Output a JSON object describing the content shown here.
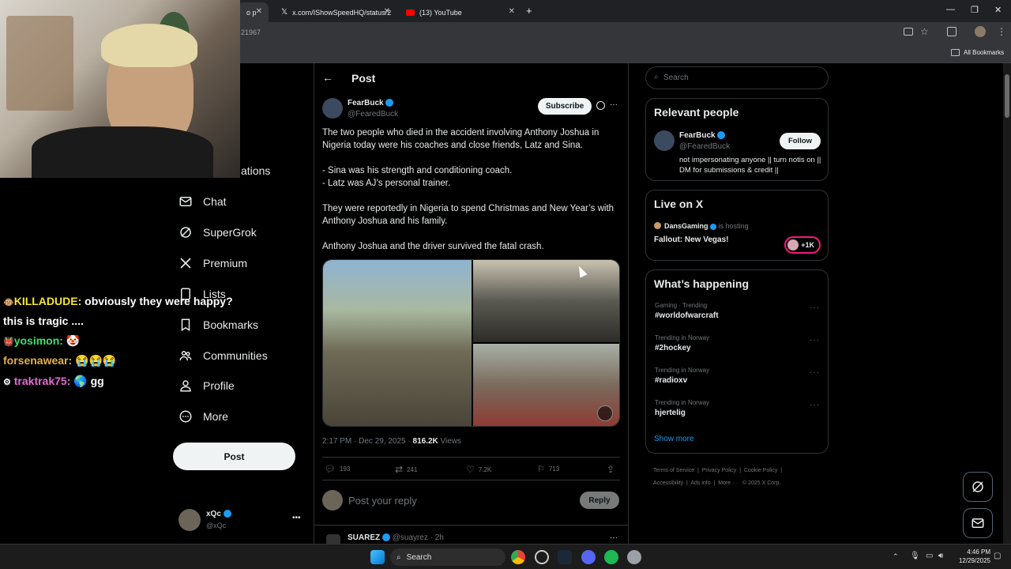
{
  "browser": {
    "tabs": [
      {
        "label": "o p"
      },
      {
        "label": "x.com/IShowSpeedHQ/status/2"
      },
      {
        "label": "(13) YouTube"
      }
    ],
    "url_fragment": "21967",
    "bookmarks_label": "All Bookmarks"
  },
  "nav": {
    "partial_notifications": "ations",
    "items": [
      "Chat",
      "SuperGrok",
      "Premium",
      "Lists",
      "Bookmarks",
      "Communities",
      "Profile",
      "More"
    ],
    "post_button": "Post",
    "account": {
      "name": "xQc",
      "handle": "@xQc"
    }
  },
  "post": {
    "header_title": "Post",
    "author_name": "FearBuck",
    "author_handle": "@FearedBuck",
    "subscribe_label": "Subscribe",
    "text": [
      "The two people who died in the accident involving Anthony Joshua in Nigeria today were his coaches and close friends, Latz and Sina.",
      "- Sina was his strength and conditioning coach.",
      "- Latz was AJ’s personal trainer.",
      "They were reportedly in Nigeria to spend Christmas and New Year’s with Anthony Joshua and his family.",
      "Anthony Joshua and the driver survived the fatal crash."
    ],
    "timestamp": "2:17 PM · Dec 29, 2025 · ",
    "views_count": "816.2K",
    "views_label": " Views",
    "stats": {
      "replies": "193",
      "reposts": "241",
      "likes": "7.2K",
      "bookmarks": "713"
    },
    "reply_placeholder": "Post your reply",
    "reply_button": "Reply",
    "next_reply": {
      "name": "SUAREZ",
      "handle": "@suayrez · 2h"
    }
  },
  "sidebar": {
    "search_placeholder": "Search",
    "relevant": {
      "title": "Relevant people",
      "name": "FearBuck",
      "handle": "@FearedBuck",
      "follow_label": "Follow",
      "bio": "not impersonating anyone || turn notis on || DM for submissions & credit ||"
    },
    "live": {
      "title": "Live on X",
      "host": "DansGaming",
      "hosting_label": "is hosting",
      "show": "Fallout: New Vegas!",
      "count": "+1K"
    },
    "happening": {
      "title": "What’s happening",
      "trends": [
        {
          "context": "Gaming · Trending",
          "name": "#worldofwarcraft"
        },
        {
          "context": "Trending in Norway",
          "name": "#2hockey"
        },
        {
          "context": "Trending in Norway",
          "name": "#radioxv"
        },
        {
          "context": "Trending in Norway",
          "name": "hjertelig"
        }
      ],
      "show_more": "Show more"
    },
    "footer": [
      "Terms of Service",
      "Privacy Policy",
      "Cookie Policy",
      "Accessibility",
      "Ads info",
      "More ···",
      "© 2025 X Corp."
    ]
  },
  "chat": {
    "messages": [
      {
        "user": "KILLADUDE:",
        "text": " obviously they were happy?",
        "color": "#f5e633"
      },
      {
        "user": "",
        "text": "this is tragic ....",
        "color": "#ffffff"
      },
      {
        "user": "yosimon:",
        "text": "",
        "color": "#3ee06b"
      },
      {
        "user": "forsenawear:",
        "text": " 😭😭😭",
        "color": "#e6b04a"
      },
      {
        "user": "traktrak75:",
        "text": " 🌎 gg",
        "color": "#e86ad6"
      }
    ]
  },
  "taskbar": {
    "search_label": "Search",
    "time": "4:46 PM",
    "date": "12/29/2025"
  },
  "colors": {
    "accent": "#1d9bf0",
    "border": "#2f3336",
    "muted": "#71767b"
  }
}
